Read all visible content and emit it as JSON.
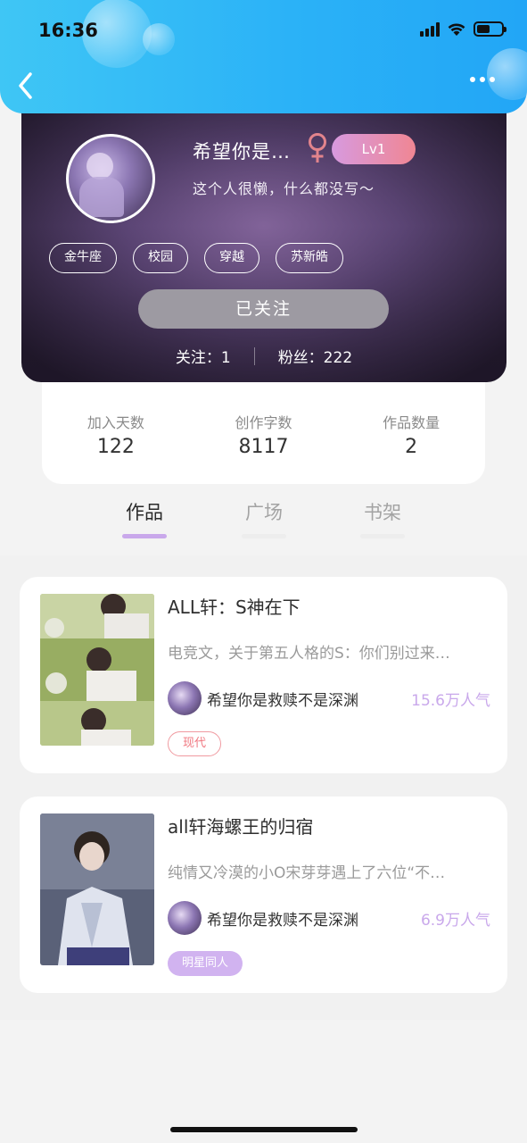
{
  "status_bar": {
    "time": "16:36"
  },
  "profile": {
    "username": "希望你是…",
    "level": "Lv1",
    "bio": "这个人很懒，什么都没写～",
    "tags": [
      "金牛座",
      "校园",
      "穿越",
      "苏新皓"
    ],
    "follow_button": "已关注",
    "following": "关注：1",
    "followers": "粉丝：222",
    "gender_icon": "female-icon",
    "colors": {
      "level_gradient_start": "#d79adf",
      "level_gradient_end": "#f08693",
      "female_symbol": "#e2848c"
    }
  },
  "stats": [
    {
      "label": "加入天数",
      "value": "122"
    },
    {
      "label": "创作字数",
      "value": "8117"
    },
    {
      "label": "作品数量",
      "value": "2"
    }
  ],
  "tabs": [
    {
      "label": "作品",
      "active": true
    },
    {
      "label": "广场",
      "active": false
    },
    {
      "label": "书架",
      "active": false
    }
  ],
  "books": [
    {
      "title": "ALL轩：S神在下",
      "description": "电竞文，关于第五人格的S：你们别过来…",
      "author": "希望你是救赎不是深渊",
      "popularity": "15.6万人气",
      "genre": "现代"
    },
    {
      "title": "all轩海螺王的归宿",
      "description": "纯情又冷漠的小O宋芽芽遇上了六位“不…",
      "author": "希望你是救赎不是深渊",
      "popularity": "6.9万人气",
      "genre": "明星同人"
    }
  ],
  "theme": {
    "header_blue": "#2bb2f7",
    "accent_purple": "#c9a8eb"
  }
}
